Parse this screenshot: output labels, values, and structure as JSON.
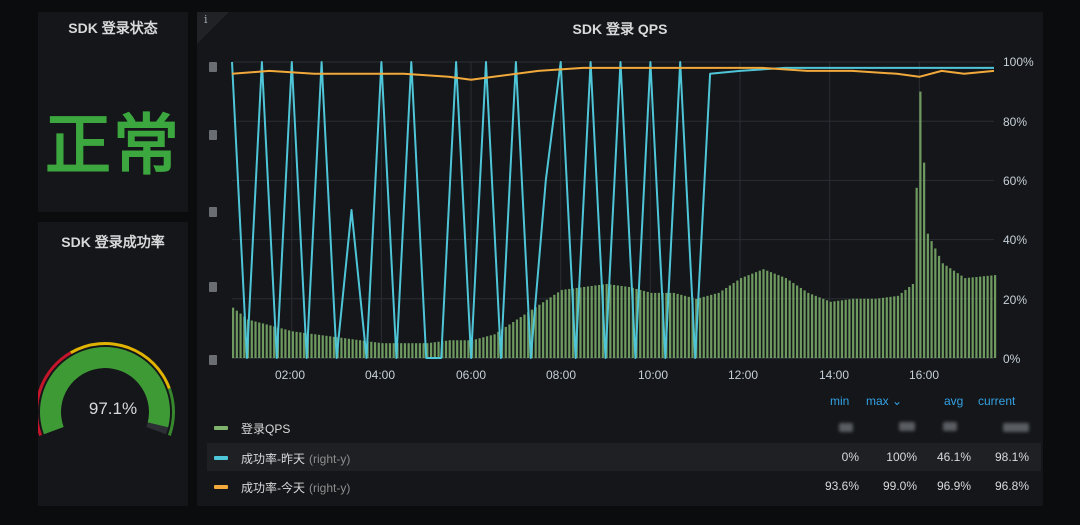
{
  "status_panel": {
    "title": "SDK 登录状态",
    "value": "正常",
    "color": "#3ca63f"
  },
  "rate_panel": {
    "title": "SDK 登录成功率",
    "gauge_value": "97.1%",
    "gauge_fraction": 0.971,
    "colors": {
      "ok": "#37872d",
      "warn": "#e0b400",
      "bad": "#c4162a"
    }
  },
  "qps_panel": {
    "title": "SDK 登录 QPS",
    "info_icon": "i",
    "right_axis_ticks": [
      "100%",
      "80%",
      "60%",
      "40%",
      "20%",
      "0%"
    ],
    "x_ticks": [
      "02:00",
      "04:00",
      "06:00",
      "08:00",
      "10:00",
      "12:00",
      "14:00",
      "16:00"
    ],
    "legend": {
      "headers": {
        "min": "min",
        "max": "max ⌄",
        "avg": "avg",
        "current": "current"
      },
      "rows": [
        {
          "name": "登录QPS",
          "axis": "",
          "color": "#7eb26d",
          "min": "",
          "max": "",
          "avg": "",
          "current": ""
        },
        {
          "name": "成功率-昨天",
          "axis": "(right-y)",
          "color": "#4fc5d8",
          "min": "0%",
          "max": "100%",
          "avg": "46.1%",
          "current": "98.1%"
        },
        {
          "name": "成功率-今天",
          "axis": "(right-y)",
          "color": "#f2a93b",
          "min": "93.6%",
          "max": "99.0%",
          "avg": "96.9%",
          "current": "96.8%"
        }
      ]
    }
  },
  "chart_data": {
    "type": "line",
    "x_range": [
      "00:40",
      "17:40"
    ],
    "x_ticks": [
      "02:00",
      "04:00",
      "06:00",
      "08:00",
      "10:00",
      "12:00",
      "14:00",
      "16:00"
    ],
    "y_right": {
      "ticks": [
        "0%",
        "20%",
        "40%",
        "60%",
        "80%",
        "100%"
      ],
      "range": [
        0,
        100
      ]
    },
    "series": [
      {
        "name": "登录QPS",
        "kind": "bars",
        "color": "#7eb26d",
        "axis": "left",
        "x": [
          "00:40",
          "01:00",
          "01:30",
          "02:00",
          "02:30",
          "03:00",
          "03:30",
          "04:00",
          "04:30",
          "05:00",
          "05:30",
          "06:00",
          "06:30",
          "07:00",
          "07:30",
          "08:00",
          "08:30",
          "09:00",
          "09:30",
          "10:00",
          "10:30",
          "11:00",
          "11:30",
          "12:00",
          "12:30",
          "13:00",
          "13:30",
          "14:00",
          "14:30",
          "15:00",
          "15:30",
          "15:50",
          "16:00",
          "16:10",
          "16:30",
          "17:00",
          "17:40"
        ],
        "values": [
          17,
          13,
          11,
          9,
          8,
          7,
          6,
          5,
          5,
          5,
          6,
          6,
          8,
          13,
          18,
          23,
          24,
          25,
          24,
          22,
          22,
          20,
          22,
          27,
          30,
          27,
          22,
          19,
          20,
          20,
          21,
          25,
          90,
          42,
          32,
          27,
          28
        ]
      },
      {
        "name": "成功率-昨天",
        "axis": "right",
        "color": "#4fc5d8",
        "x": [
          "00:40",
          "01:00",
          "01:20",
          "01:40",
          "02:00",
          "02:20",
          "02:40",
          "03:00",
          "03:20",
          "03:40",
          "04:00",
          "04:20",
          "04:40",
          "05:00",
          "05:20",
          "05:40",
          "06:00",
          "06:20",
          "06:40",
          "07:00",
          "07:20",
          "07:40",
          "08:00",
          "08:20",
          "08:40",
          "09:00",
          "09:20",
          "09:40",
          "10:00",
          "10:20",
          "10:40",
          "11:00",
          "11:20",
          "12:00",
          "13:00",
          "14:00",
          "15:00",
          "16:00",
          "17:00",
          "17:40"
        ],
        "values": [
          100,
          0,
          100,
          0,
          100,
          0,
          100,
          0,
          50,
          0,
          100,
          0,
          100,
          0,
          0,
          100,
          0,
          100,
          0,
          100,
          0,
          60,
          100,
          0,
          100,
          0,
          100,
          0,
          100,
          0,
          100,
          0,
          96,
          97,
          98,
          98,
          98,
          98,
          98,
          98
        ]
      },
      {
        "name": "成功率-今天",
        "axis": "right",
        "color": "#f2a93b",
        "x": [
          "00:40",
          "01:30",
          "02:30",
          "03:30",
          "04:30",
          "05:30",
          "06:00",
          "06:30",
          "07:30",
          "08:30",
          "09:30",
          "10:30",
          "11:30",
          "12:30",
          "13:30",
          "14:30",
          "15:30",
          "16:00",
          "16:30",
          "17:00",
          "17:40"
        ],
        "values": [
          96,
          97,
          96,
          96,
          96,
          95,
          94,
          95,
          97,
          98,
          98,
          98,
          98,
          98,
          97,
          97,
          96,
          95,
          97,
          96,
          97
        ]
      }
    ]
  }
}
